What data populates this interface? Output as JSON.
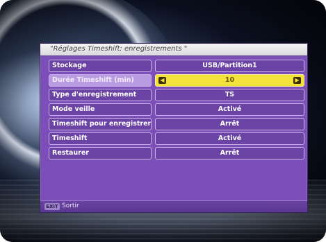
{
  "menu": {
    "title": "\"Réglages Timeshift: enregistrements \"",
    "rows": [
      {
        "label": "Stockage",
        "value": "USB/Partition1"
      },
      {
        "label": "Durée Timeshift (min)",
        "value": "10",
        "selected": true
      },
      {
        "label": "Type d'enregistrement",
        "value": "TS"
      },
      {
        "label": "Mode veille",
        "value": "Activé"
      },
      {
        "label": "Timeshift pour enregistrer",
        "value": "Arrêt"
      },
      {
        "label": "Timeshift",
        "value": "Activé"
      },
      {
        "label": "Restaurer",
        "value": "Arrêt"
      }
    ]
  },
  "footer": {
    "exit_key": "EXIT",
    "exit_label": "Sortir"
  },
  "icons": {
    "left_arrow": "triangle-left",
    "right_arrow": "triangle-right"
  },
  "colors": {
    "panel": "#7b4fb7",
    "highlight": "#f2e23a"
  }
}
